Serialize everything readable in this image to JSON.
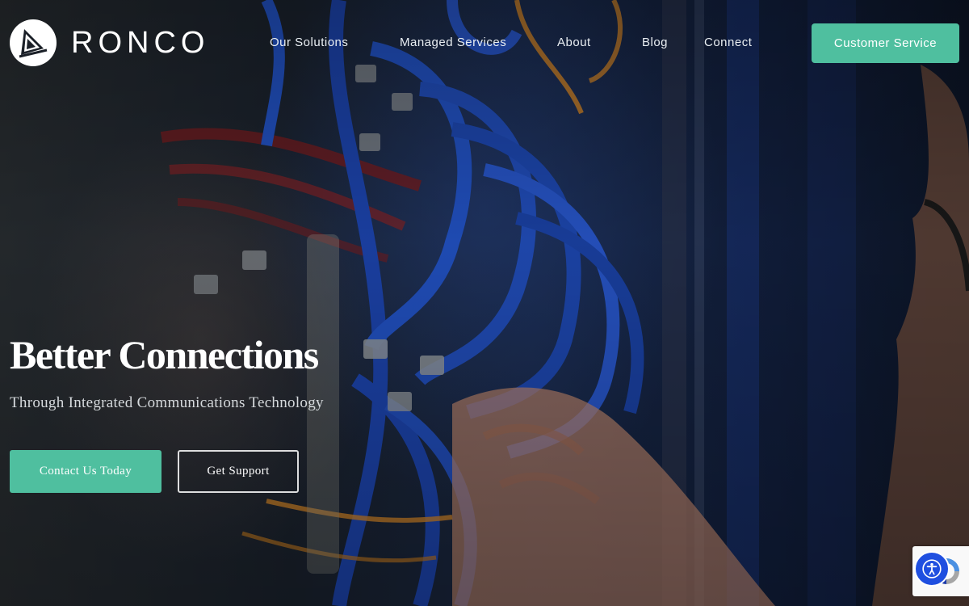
{
  "brand": {
    "name": "RONCO"
  },
  "nav": {
    "items": [
      {
        "label": "Our Solutions"
      },
      {
        "label": "Managed Services"
      },
      {
        "label": "About"
      },
      {
        "label": "Blog"
      },
      {
        "label": "Connect"
      }
    ],
    "cta_label": "Customer Service"
  },
  "hero": {
    "title": "Better Connections",
    "subtitle": "Through Integrated Communications Technology",
    "primary_button": "Contact Us Today",
    "secondary_button": "Get Support",
    "background_icon": "server-rack-cables-photo"
  },
  "widgets": {
    "accessibility_icon": "accessibility-icon",
    "recaptcha_icon": "recaptcha-icon"
  },
  "colors": {
    "accent": "#4fbf9f",
    "accessibility": "#1f4fe0",
    "text": "#ffffff"
  }
}
